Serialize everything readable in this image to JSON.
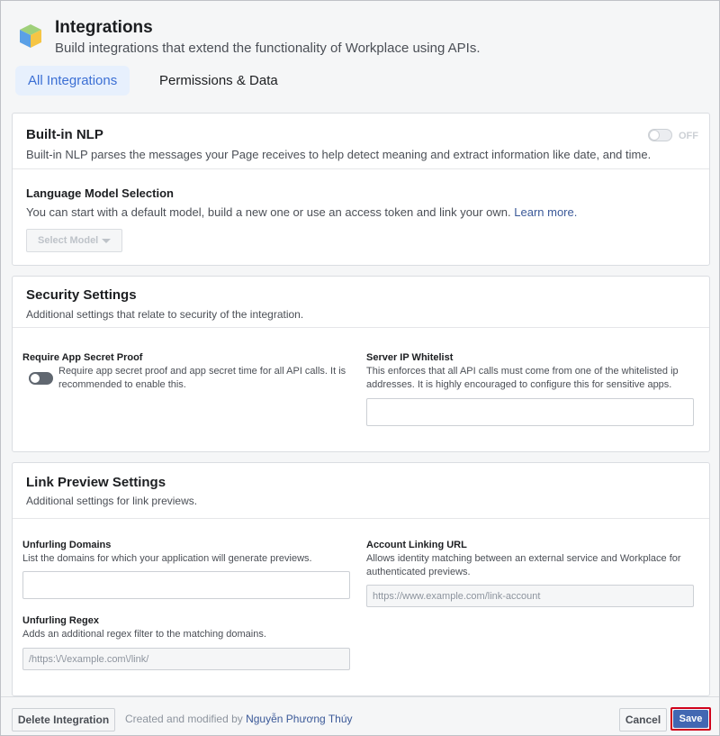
{
  "header": {
    "title": "Integrations",
    "subtitle": "Build integrations that extend the functionality of Workplace using APIs.",
    "tabs": [
      {
        "label": "All Integrations",
        "active": true
      },
      {
        "label": "Permissions & Data",
        "active": false
      }
    ]
  },
  "nlp": {
    "title": "Built-in NLP",
    "toggle_label": "OFF",
    "description": "Built-in NLP parses the messages your Page receives to help detect meaning and extract information like date, and time.",
    "model_title": "Language Model Selection",
    "model_description": "You can start with a default model, build a new one or use an access token and link your own.",
    "learn_more": "Learn more.",
    "select_model": "Select Model"
  },
  "security": {
    "title": "Security Settings",
    "description": "Additional settings that relate to security of the integration.",
    "secret_proof_label": "Require App Secret Proof",
    "secret_proof_desc": "Require app secret proof and app secret time for all API calls. It is recommended to enable this.",
    "ip_whitelist_label": "Server IP Whitelist",
    "ip_whitelist_desc": "This enforces that all API calls must come from one of the whitelisted ip addresses. It is highly encouraged to configure this for sensitive apps.",
    "ip_whitelist_value": ""
  },
  "link_preview": {
    "title": "Link Preview Settings",
    "description": "Additional settings for link previews.",
    "domains_label": "Unfurling Domains",
    "domains_desc": "List the domains for which your application will generate previews.",
    "domains_value": "",
    "regex_label": "Unfurling Regex",
    "regex_desc": "Adds an additional regex filter to the matching domains.",
    "regex_placeholder": "/https:\\/\\/example.com\\/link/",
    "account_label": "Account Linking URL",
    "account_desc": "Allows identity matching between an external service and Workplace for authenticated previews.",
    "account_placeholder": "https://www.example.com/link-account"
  },
  "footer": {
    "delete_label": "Delete Integration",
    "created_text": "Created and modified by",
    "created_by": "Nguyễn Phương Thúy",
    "cancel_label": "Cancel",
    "save_label": "Save"
  },
  "colors": {
    "accent": "#4267b2",
    "tab_active_bg": "#e7f0fd",
    "tab_active_text": "#3b6fd4",
    "save_highlight": "#d0021b"
  },
  "icons": {
    "app_logo": "cube-icon",
    "select_caret": "chevron-down-icon"
  }
}
